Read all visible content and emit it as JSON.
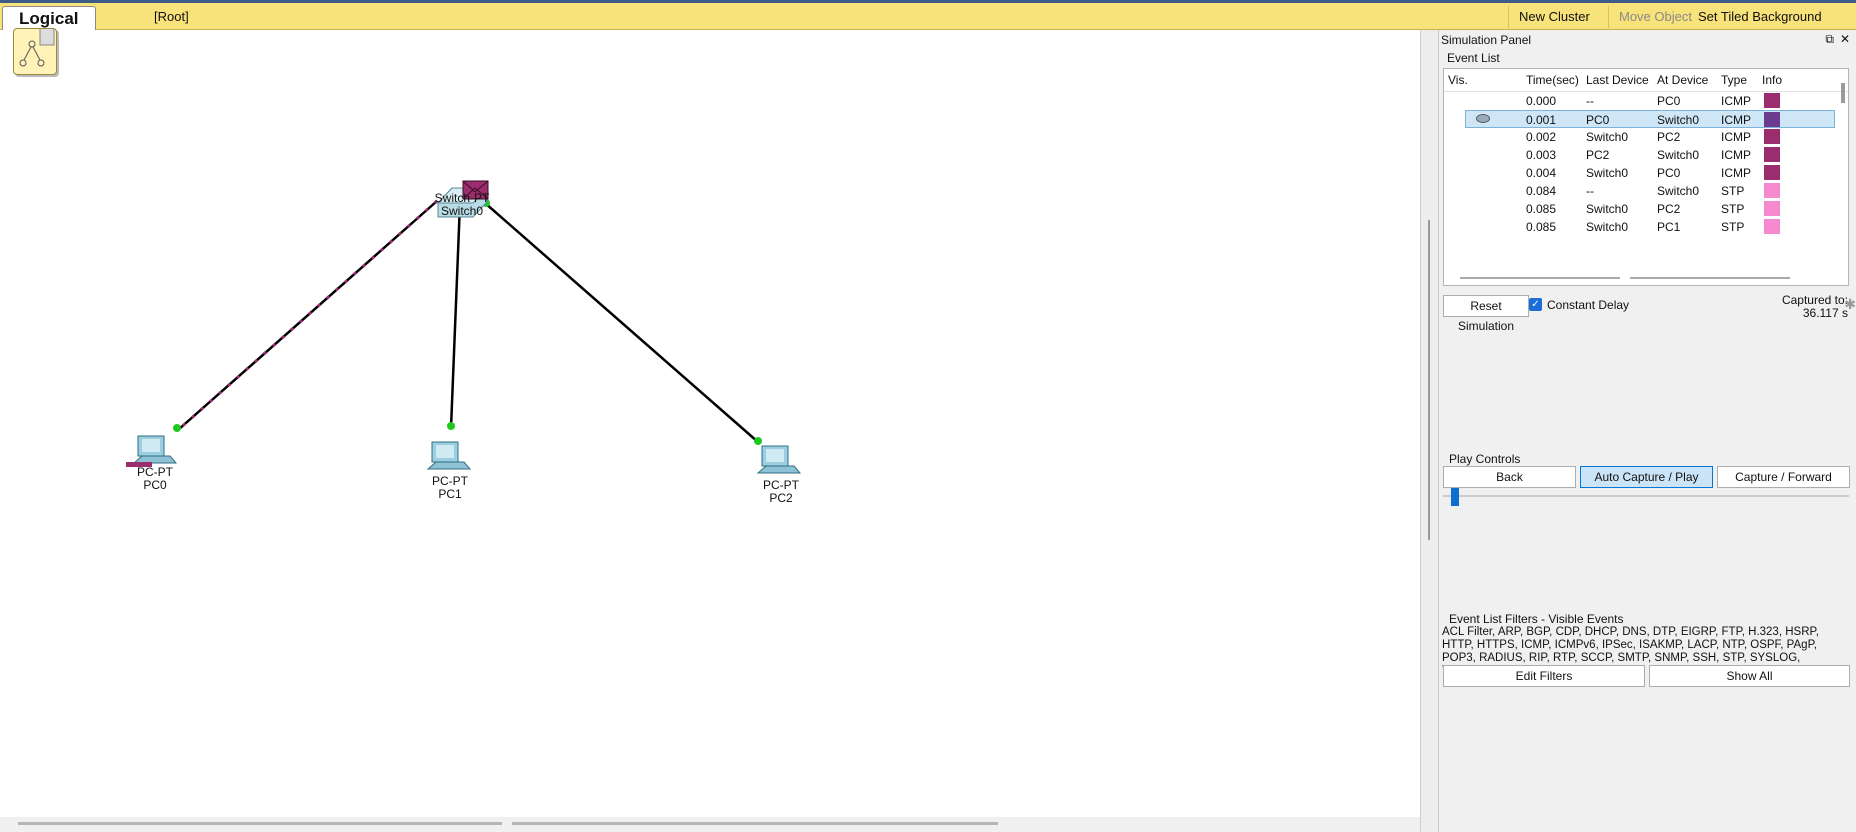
{
  "toolbar": {
    "logical_label": "Logical",
    "root_label": "[Root]",
    "new_cluster": "New Cluster",
    "move_object": "Move Object",
    "set_tiled_background": "Set Tiled Background"
  },
  "devices": {
    "switch0": {
      "model": "Switch-PT",
      "name": "Switch0"
    },
    "pc0": {
      "model": "PC-PT",
      "name": "PC0"
    },
    "pc1": {
      "model": "PC-PT",
      "name": "PC1"
    },
    "pc2": {
      "model": "PC-PT",
      "name": "PC2"
    }
  },
  "sim_panel": {
    "title": "Simulation Panel",
    "event_list_label": "Event List",
    "columns": {
      "vis": "Vis.",
      "time": "Time(sec)",
      "last_device": "Last Device",
      "at_device": "At Device",
      "type": "Type",
      "info": "Info"
    },
    "events": [
      {
        "time": "0.000",
        "last": "--",
        "at": "PC0",
        "type": "ICMP",
        "color": "#9b2d6e"
      },
      {
        "time": "0.001",
        "last": "PC0",
        "at": "Switch0",
        "type": "ICMP",
        "color": "#6a3b8f"
      },
      {
        "time": "0.002",
        "last": "Switch0",
        "at": "PC2",
        "type": "ICMP",
        "color": "#9b2d6e"
      },
      {
        "time": "0.003",
        "last": "PC2",
        "at": "Switch0",
        "type": "ICMP",
        "color": "#9b2d6e"
      },
      {
        "time": "0.004",
        "last": "Switch0",
        "at": "PC0",
        "type": "ICMP",
        "color": "#9b2d6e"
      },
      {
        "time": "0.084",
        "last": "--",
        "at": "Switch0",
        "type": "STP",
        "color": "#f58ad0"
      },
      {
        "time": "0.085",
        "last": "Switch0",
        "at": "PC2",
        "type": "STP",
        "color": "#f58ad0"
      },
      {
        "time": "0.085",
        "last": "Switch0",
        "at": "PC1",
        "type": "STP",
        "color": "#f58ad0"
      }
    ],
    "reset_simulation": "Reset Simulation",
    "constant_delay": "Constant Delay",
    "captured_label": "Captured to:",
    "captured_value": "36.117 s",
    "play_controls_label": "Play Controls",
    "back": "Back",
    "auto_capture_play": "Auto Capture / Play",
    "capture_forward": "Capture / Forward",
    "filters_label": "Event List Filters - Visible Events",
    "filters_text": "ACL Filter, ARP, BGP, CDP, DHCP, DNS, DTP, EIGRP, FTP, H.323, HSRP, HTTP, HTTPS, ICMP, ICMPv6, IPSec, ISAKMP, LACP, NTP, OSPF, PAgP, POP3, RADIUS, RIP, RTP, SCCP, SMTP, SNMP, SSH, STP, SYSLOG, TACACS, TCP, TFTP, Telnet, UDP, VTP",
    "edit_filters": "Edit Filters",
    "show_all": "Show All"
  },
  "colors": {
    "toolbar": "#f8e27a",
    "icmp": "#9b2d6e",
    "stp": "#f58ad0",
    "link_port": "#1ec81e",
    "selected_row": "#cfe6f7"
  }
}
